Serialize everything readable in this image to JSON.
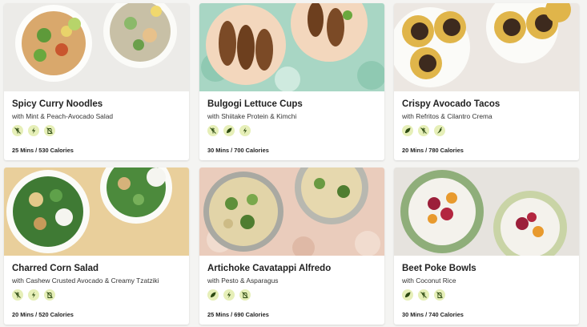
{
  "recipes": [
    {
      "title": "Spicy Curry Noodles",
      "subtitle": "with Mint & Peach-Avocado Salad",
      "meta": "25 Mins / 530 Calories",
      "icons": [
        "no-gluten-icon",
        "lightning-icon",
        "no-dairy-icon"
      ]
    },
    {
      "title": "Bulgogi Lettuce Cups",
      "subtitle": "with Shiitake Protein & Kimchi",
      "meta": "30 Mins / 700 Calories",
      "icons": [
        "no-gluten-icon",
        "leaf-icon",
        "lightning-icon"
      ]
    },
    {
      "title": "Crispy Avocado Tacos",
      "subtitle": "with Refritos & Cilantro Crema",
      "meta": "20 Mins / 780 Calories",
      "icons": [
        "leaf-icon",
        "no-gluten-icon",
        "pepper-icon"
      ]
    },
    {
      "title": "Charred Corn Salad",
      "subtitle": "with Cashew Crusted Avocado & Creamy Tzatziki",
      "meta": "20 Mins / 520 Calories",
      "icons": [
        "no-gluten-icon",
        "lightning-icon",
        "no-dairy-icon"
      ]
    },
    {
      "title": "Artichoke Cavatappi Alfredo",
      "subtitle": "with Pesto & Asparagus",
      "meta": "25 Mins / 690 Calories",
      "icons": [
        "leaf-icon",
        "lightning-icon",
        "no-dairy-icon"
      ]
    },
    {
      "title": "Beet Poke Bowls",
      "subtitle": "with Coconut Rice",
      "meta": "30 Mins / 740 Calories",
      "icons": [
        "leaf-icon",
        "no-gluten-icon",
        "no-dairy-icon"
      ]
    }
  ],
  "colors": {
    "icon_bg": "#e6efb8",
    "icon_fg": "#2d4a12",
    "card_bg": "#ffffff",
    "page_bg": "#f4f4f2"
  }
}
